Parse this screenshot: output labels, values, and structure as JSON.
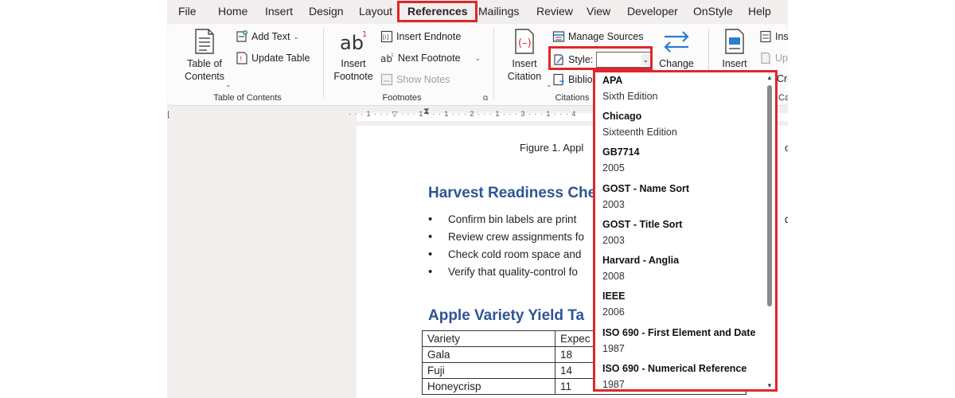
{
  "menu": [
    "File",
    "Home",
    "Insert",
    "Design",
    "Layout",
    "References",
    "Mailings",
    "Review",
    "View",
    "Developer",
    "OnStyle",
    "Help"
  ],
  "ribbon": {
    "toc": {
      "table_of_contents": "Table of Contents",
      "add_text": "Add Text",
      "update_table": "Update Table",
      "group_label": "Table of Contents"
    },
    "footnotes": {
      "insert_footnote": "Insert Footnote",
      "insert_endnote": "Insert Endnote",
      "next_footnote": "Next Footnote",
      "show_notes": "Show Notes",
      "group_label": "Footnotes"
    },
    "citations": {
      "insert_citation": "Insert Citation",
      "manage_sources": "Manage Sources",
      "style_label": "Style:",
      "style_value": "",
      "bibliography": "Biblio",
      "group_label": "Citations"
    },
    "change": "Change",
    "captions": {
      "insert": "Insert",
      "ins": "Ins",
      "up": "Up",
      "cro": "Cro",
      "ca": "Ca"
    }
  },
  "ruler": "· · · 1 · · · ▽ · · · 1 · · · 1 · · · 2 · · · 1 · · · 3 · · · 1 · · · 4",
  "document": {
    "caption": "Figure 1. Appl",
    "caption_tail": "op",
    "heading1": "Harvest Readiness Che",
    "bullets": [
      {
        "text": "Confirm bin labels are print",
        "tail": "da"
      },
      {
        "text": "Review crew assignments fo",
        "tail": ""
      },
      {
        "text": "Check cold room space and",
        "tail": ""
      },
      {
        "text": "Verify that quality-control fo",
        "tail": ""
      }
    ],
    "heading2": "Apple Variety Yield Ta",
    "table": [
      [
        "Variety",
        "Expec"
      ],
      [
        "Gala",
        "18"
      ],
      [
        "Fuji",
        "14"
      ],
      [
        "Honeycrisp",
        "11"
      ]
    ]
  },
  "styles_dropdown": [
    {
      "name": "APA",
      "edition": "Sixth Edition"
    },
    {
      "name": "Chicago",
      "edition": "Sixteenth Edition"
    },
    {
      "name": "GB7714",
      "edition": "2005"
    },
    {
      "name": "GOST - Name Sort",
      "edition": "2003"
    },
    {
      "name": "GOST - Title Sort",
      "edition": "2003"
    },
    {
      "name": "Harvard - Anglia",
      "edition": "2008"
    },
    {
      "name": "IEEE",
      "edition": "2006"
    },
    {
      "name": "ISO 690 - First Element and Date",
      "edition": "1987"
    },
    {
      "name": "ISO 690 - Numerical Reference",
      "edition": "1987"
    }
  ],
  "colors": {
    "highlight": "#e0262b",
    "heading": "#2f5496",
    "accent_blue": "#2b7cd3"
  }
}
